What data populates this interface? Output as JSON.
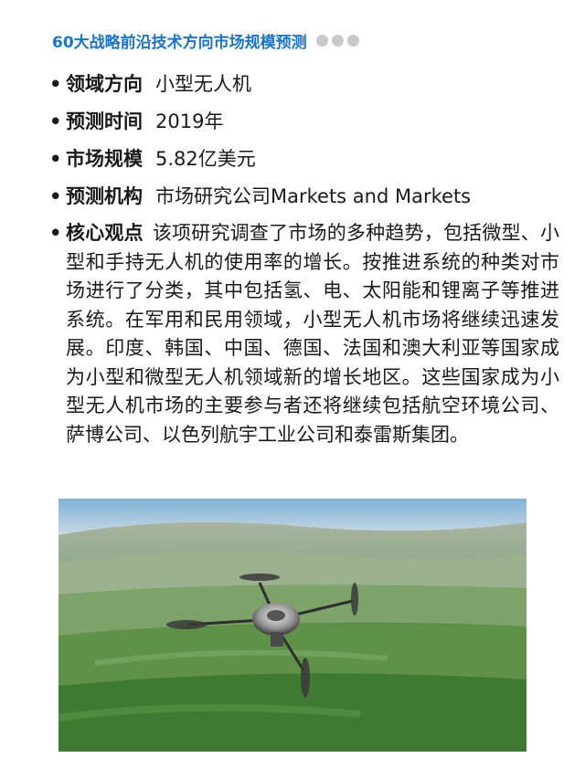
{
  "header": {
    "title": "60大战略前沿技术方向市场规模预测"
  },
  "items": [
    {
      "label": "领域方向",
      "value": "小型无人机"
    },
    {
      "label": "预测时间",
      "value": "2019年"
    },
    {
      "label": "市场规模",
      "value": "5.82亿美元"
    },
    {
      "label": "预测机构",
      "value": "市场研究公司Markets and Markets"
    }
  ],
  "core": {
    "label": "核心观点",
    "text": "该项研究调查了市场的多种趋势，包括微型、小型和手持无人机的使用率的增长。按推进系统的种类对市场进行了分类，其中包括氢、电、太阳能和锂离子等推进系统。在军用和民用领域，小型无人机市场将继续迅速发展。印度、韩国、中国、德国、法国和澳大利亚等国家成为小型和微型无人机领域新的增长地区。这些国家成为小型无人机市场的主要参与者还将继续包括航空环境公司、萨博公司、以色列航宇工业公司和泰雷斯集团。"
  },
  "bullet_char": "•"
}
